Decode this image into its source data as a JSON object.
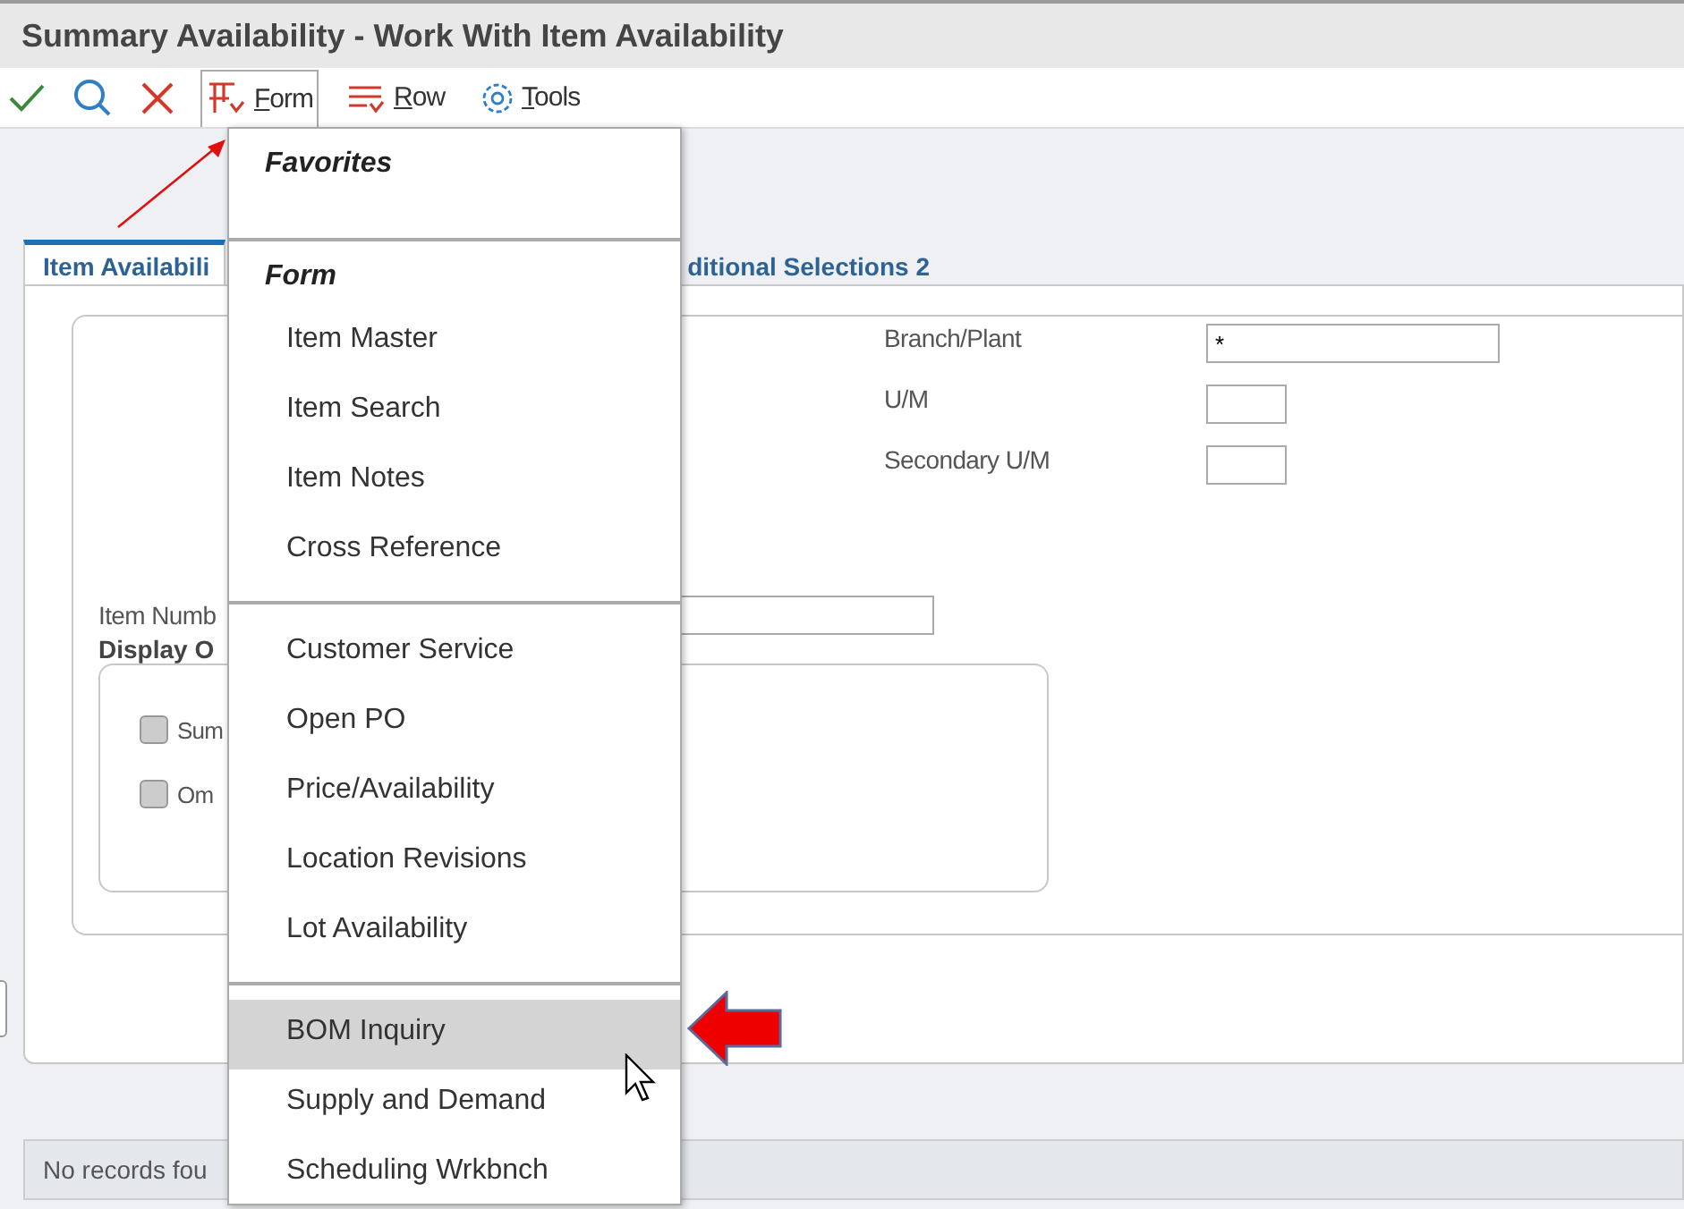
{
  "window": {
    "title": "Summary Availability - Work With Item Availability"
  },
  "toolbar": {
    "menus": [
      {
        "label": "Form",
        "kind": "form",
        "open": true
      },
      {
        "label": "Row",
        "kind": "row",
        "open": false
      },
      {
        "label": "Tools",
        "kind": "tools",
        "open": false
      }
    ]
  },
  "tabs": [
    {
      "label": "Item Availabili",
      "selected": true
    },
    {
      "label": "ditional Selections 2",
      "selected": false
    }
  ],
  "fields": [
    {
      "label": "Branch/Plant",
      "value": "*",
      "kind": "wide"
    },
    {
      "label": "U/M",
      "kind": "short"
    },
    {
      "label": "Secondary U/M",
      "kind": "short"
    }
  ],
  "item_number": {
    "label": "Item Numb"
  },
  "display_options": {
    "title": "Display O",
    "options": [
      {
        "label": "Sum",
        "checked": false
      },
      {
        "label": "Om",
        "checked": false
      }
    ]
  },
  "grid": {
    "status": "No records fou"
  },
  "menu": {
    "sections": [
      {
        "header": "Favorites"
      },
      {
        "header": "Form",
        "items": [
          {
            "label": "Item Master",
            "selected": false
          },
          {
            "label": "Item Search",
            "selected": false
          },
          {
            "label": "Item Notes",
            "selected": false
          },
          {
            "label": "Cross Reference",
            "selected": false
          }
        ]
      },
      {
        "items": [
          {
            "label": "Customer Service",
            "selected": false
          },
          {
            "label": "Open PO",
            "selected": false
          },
          {
            "label": "Price/Availability",
            "selected": false
          },
          {
            "label": "Location Revisions",
            "selected": false
          },
          {
            "label": "Lot Availability",
            "selected": false
          }
        ]
      },
      {
        "items": [
          {
            "label": "BOM Inquiry",
            "selected": true
          },
          {
            "label": "Supply and Demand",
            "selected": false
          },
          {
            "label": "Scheduling Wrkbnch",
            "selected": false
          }
        ]
      }
    ]
  }
}
